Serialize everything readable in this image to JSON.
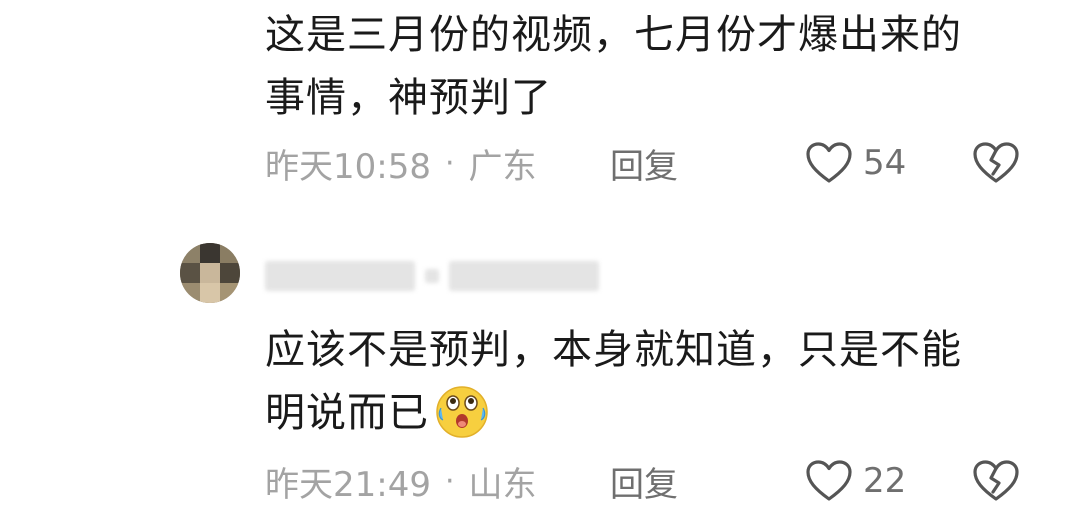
{
  "comments": [
    {
      "text_lines": [
        "这是三月份的视频，七月份才爆出来的",
        "事情，神预判了"
      ],
      "time": "昨天10:58",
      "separator": "·",
      "location": "广东",
      "reply_label": "回复",
      "likes": "54"
    },
    {
      "username_masked": true,
      "text_lines": [
        "应该不是预判，本身就知道，只是不能",
        "明说而已"
      ],
      "emoji": "laugh-cry-emoji",
      "time": "昨天21:49",
      "separator": "·",
      "location": "山东",
      "reply_label": "回复",
      "likes": "22"
    }
  ],
  "icons": {
    "like": "heart-outline-icon",
    "dislike": "broken-heart-icon"
  },
  "colors": {
    "text": "#1a1a1a",
    "meta": "#a3a3a3",
    "action": "#6f6f6f",
    "icon": "#555555"
  }
}
